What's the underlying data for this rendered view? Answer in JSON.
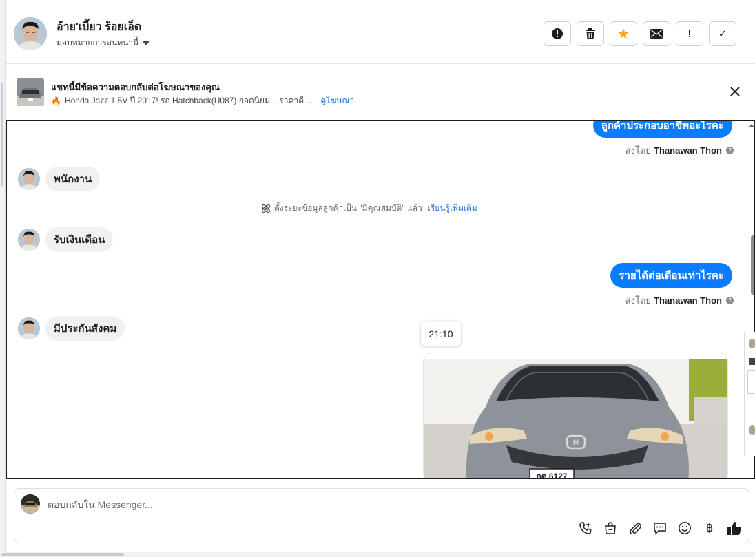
{
  "header": {
    "name": "อ้าย'เบี้ยว ร้อยเอ็ด",
    "assign_label": "มอบหมายการสนทนานี้",
    "actions": [
      {
        "name": "spam-button",
        "icon": "alert-circle-icon",
        "glyph": "!"
      },
      {
        "name": "delete-button",
        "icon": "trash-icon",
        "glyph": ""
      },
      {
        "name": "star-button",
        "icon": "star-icon",
        "glyph": "★"
      },
      {
        "name": "mark-unread-button",
        "icon": "envelope-icon",
        "glyph": ""
      },
      {
        "name": "follow-up-button",
        "icon": "exclamation-icon",
        "glyph": "!"
      },
      {
        "name": "mark-done-button",
        "icon": "check-icon",
        "glyph": "✓"
      }
    ]
  },
  "banner": {
    "title": "แชทนี้มีข้อความตอบกลับต่อโฆษณาของคุณ",
    "fire_icon": "🔥",
    "subtitle": "Honda Jazz 1.5V ปี 2017! รถ Hatchback(U087) ยอดนิยม... ราคาดี ...",
    "link": "ดูโฆษณา"
  },
  "messages": {
    "outgoing": [
      {
        "text": "ลูกค้าประกอบอาชีพอะไรคะ"
      },
      {
        "text": "รายได้ต่อเดือนเท่าไรคะ"
      }
    ],
    "sent_by_prefix": "ส่งโดย",
    "sent_by_name": "Thanawan Thon",
    "incoming": [
      {
        "text": "พนักงาน"
      },
      {
        "text": "รับเงินเดือน"
      },
      {
        "text": "มีประกันสังคม"
      }
    ],
    "system_text": "ตั้งระยะข้อมูลลูกค้าเป็น \"มีคุณสมบัติ\" แล้ว",
    "system_link": "เรียนรู้เพิ่มเติม",
    "time_tooltip": "21:10",
    "image_plate": "กต 6127"
  },
  "composer": {
    "placeholder": "ตอบกลับใน Messenger...",
    "tools": [
      "phone-plus-icon",
      "shopping-bag-icon",
      "paperclip-icon",
      "chat-bubble-icon",
      "smiley-icon",
      "baht-icon",
      "thumbs-up-icon"
    ],
    "baht_glyph": "฿"
  },
  "colors": {
    "accent": "#0a7cff",
    "link": "#216fdb",
    "star": "#f5a623"
  }
}
